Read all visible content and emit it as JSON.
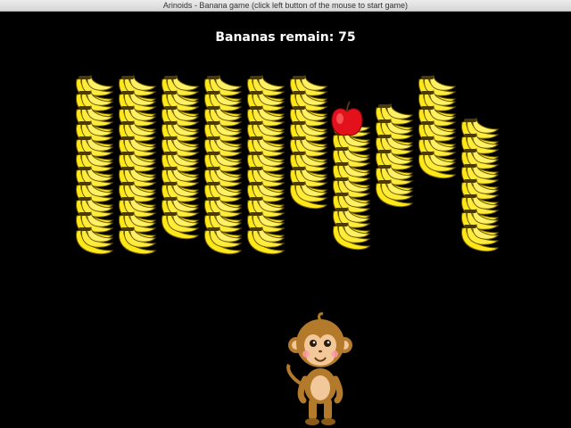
{
  "window": {
    "title": "Arinoids - Banana game (click left button of the mouse to start game)"
  },
  "hud": {
    "bananas_label": "Bananas remain:",
    "bananas_remaining": "75",
    "text_color": "#ffffff"
  },
  "colors": {
    "background": "#000000",
    "banana": "#ffe81a",
    "banana_outline": "#6b5a00",
    "apple": "#e3111b",
    "monkey": "#b27a2a"
  },
  "sprites": {
    "brick": "banana-bunch-icon",
    "ball": "apple-icon",
    "paddle": "monkey-icon"
  },
  "bricks": {
    "column_counts": [
      11,
      11,
      10,
      11,
      11,
      8,
      8,
      6,
      6,
      8
    ]
  }
}
